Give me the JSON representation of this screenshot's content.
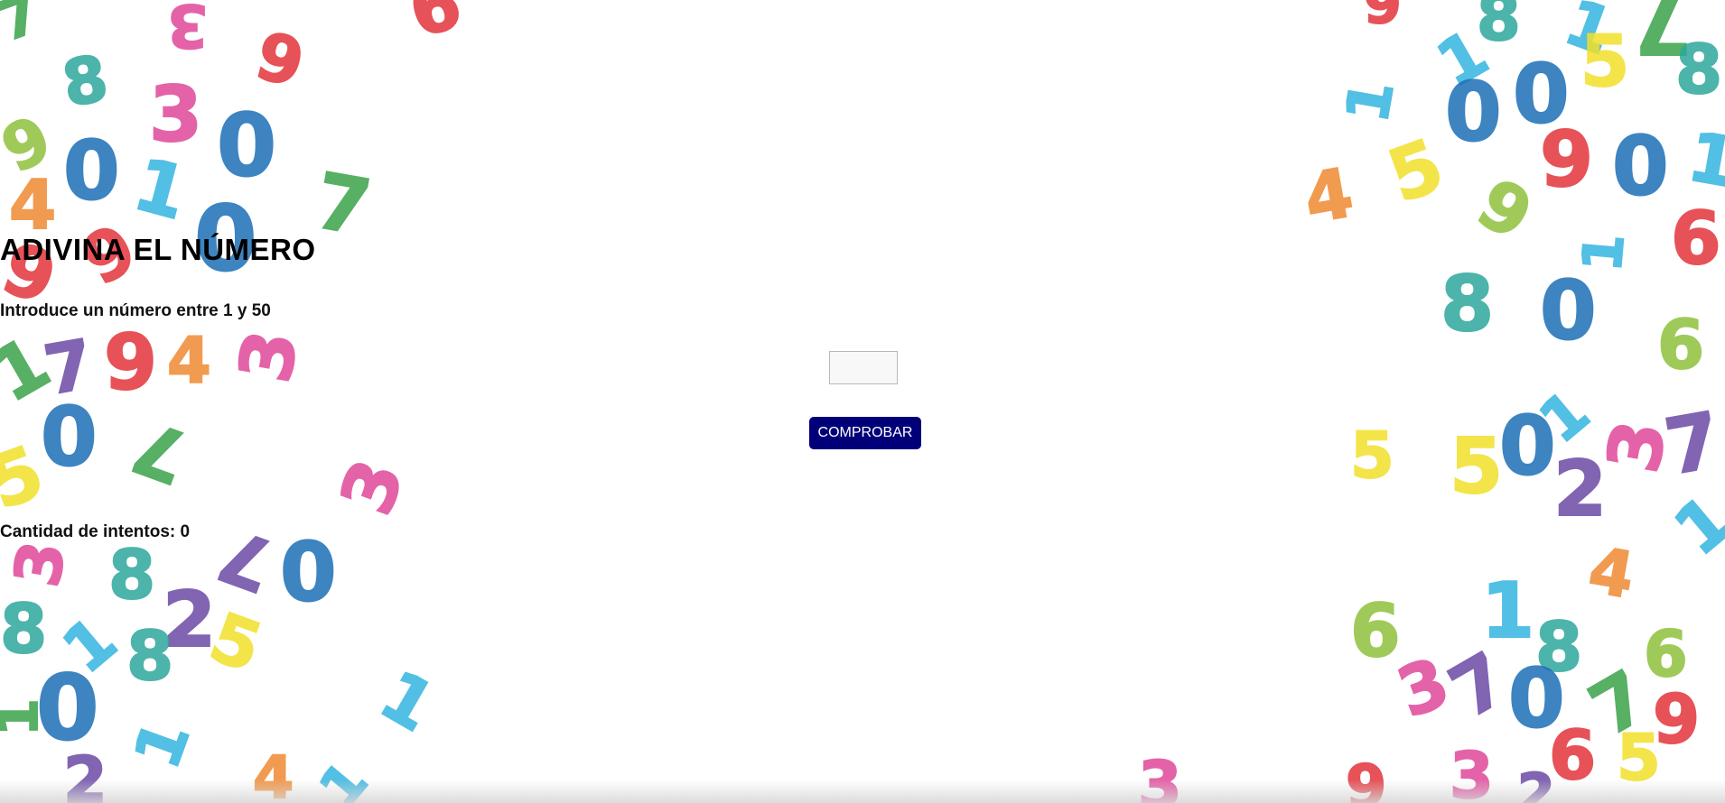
{
  "game": {
    "title": "ADIVINA EL NÚMERO",
    "prompt": "Introduce un número entre 1 y 50",
    "input_value": "",
    "input_placeholder": "",
    "check_button_label": "COMPROBAR",
    "attempts_label": "Cantidad de intentos: 0"
  },
  "colors": {
    "button_background": "#020079",
    "button_text": "#ffffff",
    "text": "#000000",
    "background": "#ffffff"
  },
  "background_image": "scattered-colorful-sketched-digits"
}
